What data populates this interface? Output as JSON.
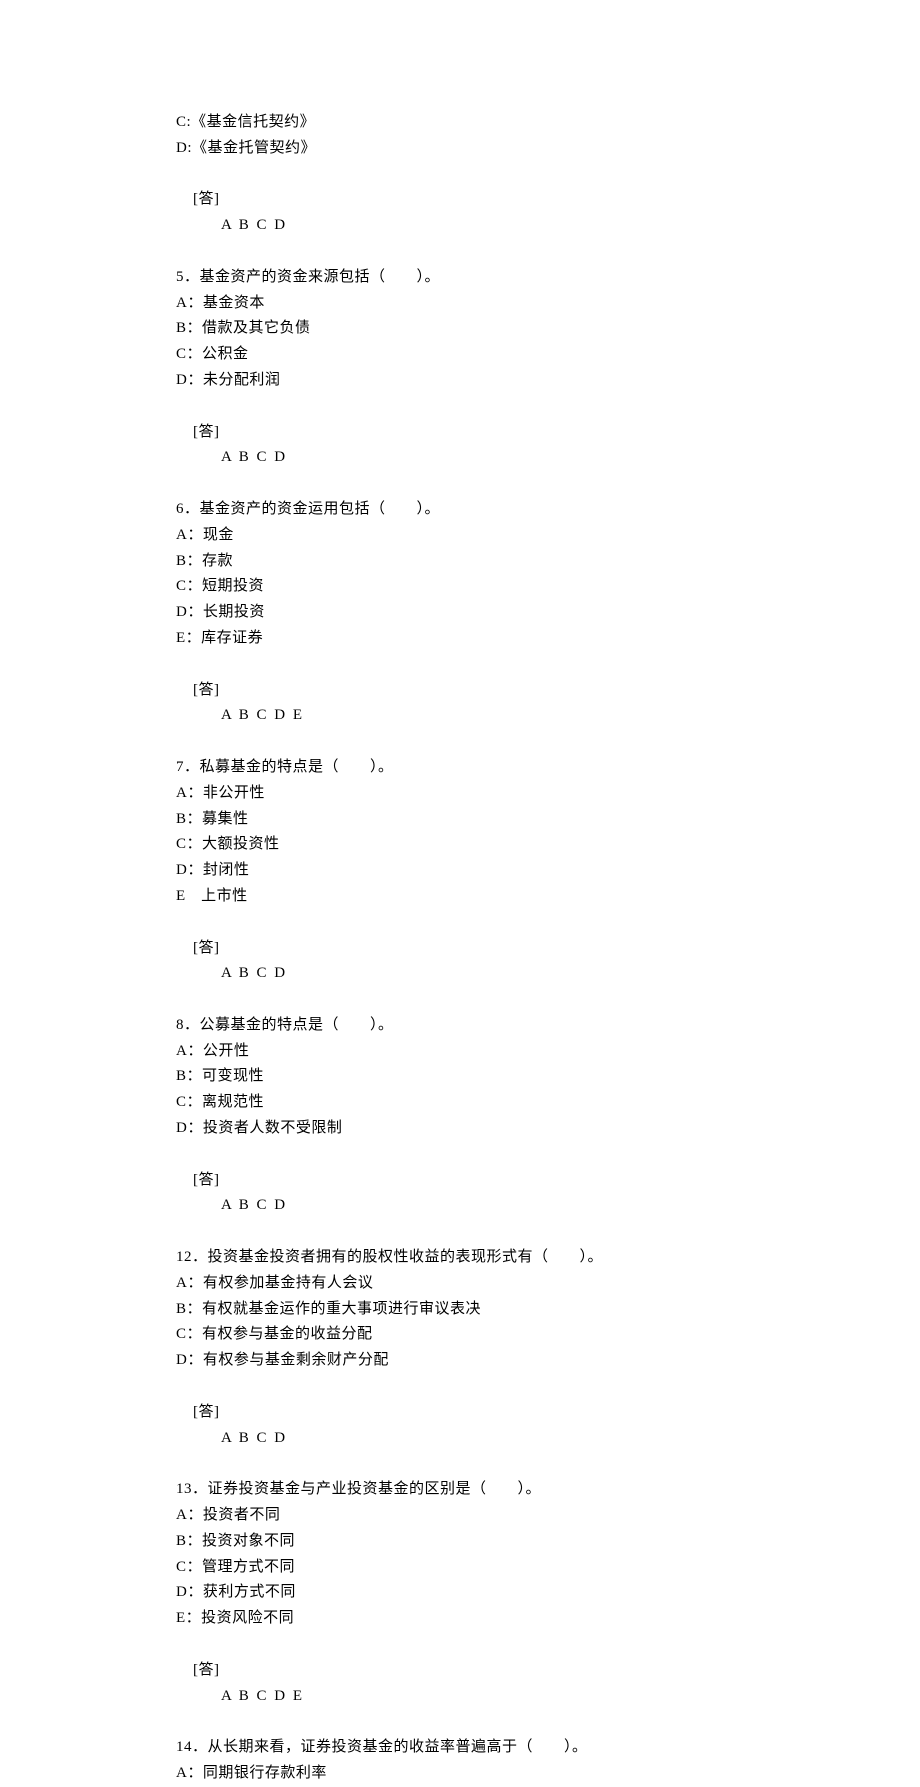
{
  "lines": [
    "C:《基金信托契约》",
    "D:《基金托管契约》"
  ],
  "answer4": {
    "label": "[答]",
    "value": "A B C D"
  },
  "q5": {
    "stem": "5．基金资产的资金来源包括（　　）。",
    "opts": [
      "A：基金资本",
      "B：借款及其它负债",
      "C：公积金",
      "D：未分配利润"
    ],
    "answer": {
      "label": "[答]",
      "value": "A B C D"
    }
  },
  "q6": {
    "stem": "6．基金资产的资金运用包括（　　）。",
    "opts": [
      "A：现金",
      "B：存款",
      "C：短期投资",
      "D：长期投资",
      "E：库存证券"
    ],
    "answer": {
      "label": "[答]",
      "value": "A B C D E"
    }
  },
  "q7": {
    "stem": "7．私募基金的特点是（　　）。",
    "opts": [
      "A：非公开性",
      "B：募集性",
      "C：大额投资性",
      "D：封闭性",
      "E　上市性"
    ],
    "answer": {
      "label": "[答]",
      "value": "A B C D"
    }
  },
  "q8": {
    "stem": "8．公募基金的特点是（　　）。",
    "opts": [
      "A：公开性",
      "B：可变现性",
      "C：离规范性",
      "D：投资者人数不受限制"
    ],
    "answer": {
      "label": "[答]",
      "value": "A B C D"
    }
  },
  "q12": {
    "stem": "12．投资基金投资者拥有的股权性收益的表现形式有（　　）。",
    "opts": [
      "A：有权参加基金持有人会议",
      "B：有权就基金运作的重大事项进行审议表决",
      "C：有权参与基金的收益分配",
      "D：有权参与基金剩余财产分配"
    ],
    "answer": {
      "label": "[答]",
      "value": "A B C D"
    }
  },
  "q13": {
    "stem": "13．证券投资基金与产业投资基金的区别是（　　）。",
    "opts": [
      "A：投资者不同",
      "B：投资对象不同",
      "C：管理方式不同",
      "D：获利方式不同",
      "E：投资风险不同"
    ],
    "answer": {
      "label": "[答]",
      "value": "A B C D E"
    }
  },
  "q14": {
    "stem": "14．从长期来看，证券投资基金的收益率普遍高于（　　）。",
    "opts": [
      "A：同期银行存款利率"
    ]
  }
}
